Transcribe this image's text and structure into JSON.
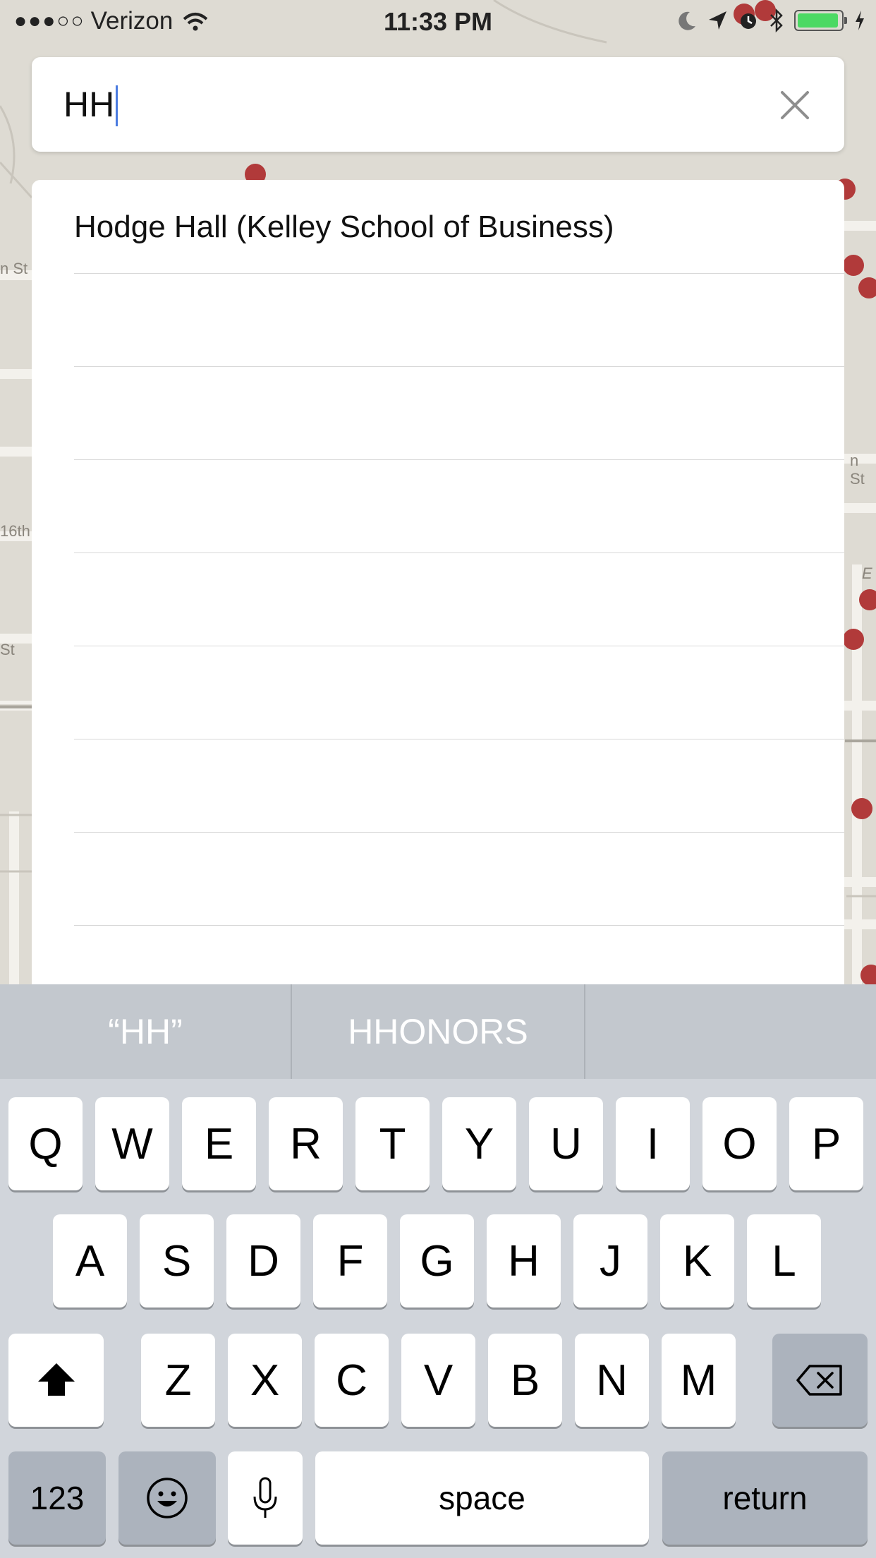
{
  "status_bar": {
    "carrier": "Verizon",
    "time": "11:33 PM",
    "battery_level": 0.95
  },
  "map": {
    "street_labels": [
      "n St",
      "16th",
      "St",
      "n St",
      "E"
    ]
  },
  "search": {
    "value": "HH",
    "clear_icon": "close-icon"
  },
  "results": [
    {
      "label": "Hodge Hall (Kelley School of Business)"
    }
  ],
  "keyboard": {
    "suggestions": [
      "“HH”",
      "HHONORS",
      ""
    ],
    "row1": [
      "Q",
      "W",
      "E",
      "R",
      "T",
      "Y",
      "U",
      "I",
      "O",
      "P"
    ],
    "row2": [
      "A",
      "S",
      "D",
      "F",
      "G",
      "H",
      "J",
      "K",
      "L"
    ],
    "row3": [
      "Z",
      "X",
      "C",
      "V",
      "B",
      "N",
      "M"
    ],
    "numbers_label": "123",
    "space_label": "space",
    "return_label": "return"
  },
  "colors": {
    "map_bg": "#dedbd3",
    "map_marker": "#b13a3a",
    "keyboard_bg": "#d1d5db",
    "caret": "#4a7be0"
  }
}
